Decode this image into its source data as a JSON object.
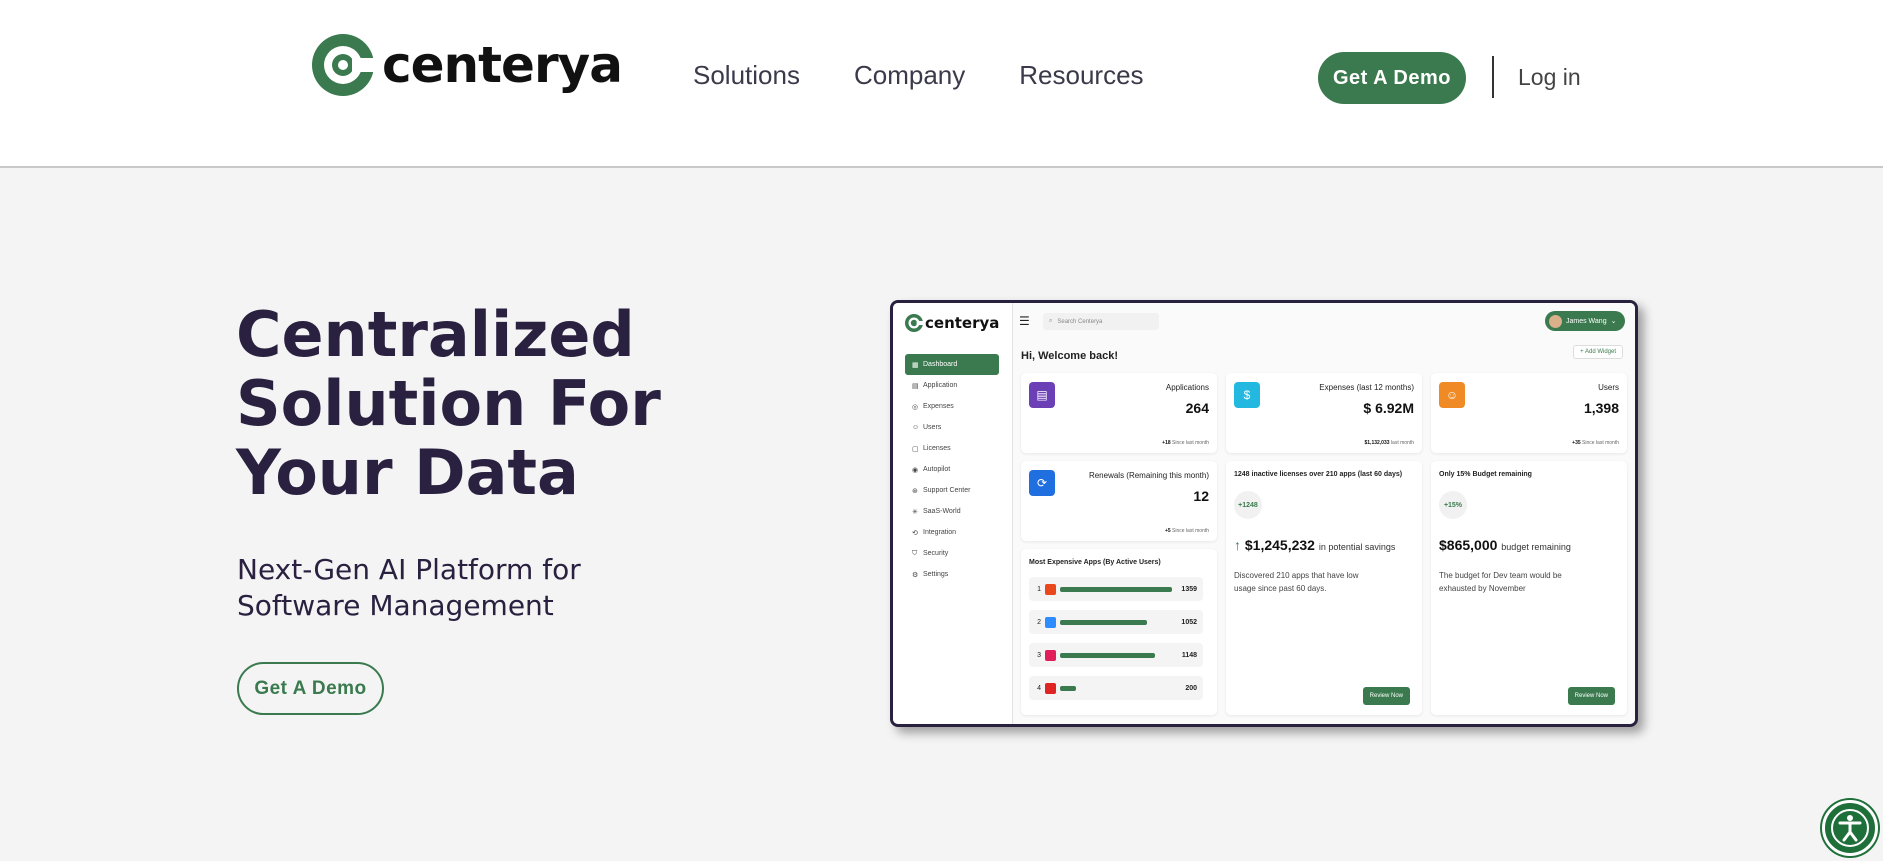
{
  "header": {
    "logo_text": "centerya",
    "nav": [
      "Solutions",
      "Company",
      "Resources"
    ],
    "cta_label": "Get A Demo",
    "login_label": "Log in",
    "brand_color": "#3a7a4e"
  },
  "hero": {
    "title": "Centralized Solution For Your Data",
    "subtitle": "Next-Gen AI Platform for Software Management",
    "cta_label": "Get A Demo"
  },
  "dashboard": {
    "logo_text": "centerya",
    "search_placeholder": "Search Centerya",
    "user_name": "James Wang",
    "welcome": "Hi, Welcome back!",
    "add_widget": "+ Add Widget",
    "menu": [
      {
        "label": "Dashboard",
        "icon": "grid-icon",
        "glyph": "▦"
      },
      {
        "label": "Application",
        "icon": "doc-icon",
        "glyph": "▤"
      },
      {
        "label": "Expenses",
        "icon": "coin-icon",
        "glyph": "◎"
      },
      {
        "label": "Users",
        "icon": "users-icon",
        "glyph": "☺"
      },
      {
        "label": "Licenses",
        "icon": "license-icon",
        "glyph": "▢"
      },
      {
        "label": "Autopilot",
        "icon": "autopilot-icon",
        "glyph": "◉"
      },
      {
        "label": "Support Center",
        "icon": "support-icon",
        "glyph": "⊛"
      },
      {
        "label": "SaaS-World",
        "icon": "world-icon",
        "glyph": "✳"
      },
      {
        "label": "Integration",
        "icon": "integration-icon",
        "glyph": "⟲"
      },
      {
        "label": "Security",
        "icon": "shield-icon",
        "glyph": "⛉"
      },
      {
        "label": "Settings",
        "icon": "gear-icon",
        "glyph": "⚙"
      }
    ],
    "stats": {
      "applications": {
        "label": "Applications",
        "value": "264",
        "since_num": "+18",
        "since_text": "Since last month",
        "color": "#6b3fb5"
      },
      "expenses": {
        "label": "Expenses (last 12 months)",
        "value": "$ 6.92M",
        "since_num": "$1,132,033",
        "since_text": "last month",
        "color": "#22b8e0"
      },
      "users": {
        "label": "Users",
        "value": "1,398",
        "since_num": "+35",
        "since_text": "Since last month",
        "color": "#f08a24"
      },
      "renewals": {
        "label": "Renewals (Remaining this month)",
        "value": "12",
        "since_num": "+5",
        "since_text": "Since last month",
        "color": "#1f6fe0"
      }
    },
    "inactive": {
      "title": "1248 inactive licenses over 210 apps (last 60 days)",
      "pill": "+1248",
      "value": "$1,245,232",
      "value_suffix": "in potential savings",
      "desc": "Discovered 210 apps that have low usage since past 60 days.",
      "button": "Review Now"
    },
    "budget": {
      "title": "Only 15% Budget remaining",
      "pill": "+15%",
      "value": "$865,000",
      "value_suffix": "budget remaining",
      "desc": "The budget for Dev team would be exhausted by November",
      "button": "Review Now"
    },
    "expensive_apps": {
      "title": "Most Expensive Apps (By Active Users)",
      "rows": [
        {
          "rank": "1",
          "icon": "office-icon",
          "icon_color": "#e8481c",
          "value": 1359,
          "label": "1359"
        },
        {
          "rank": "2",
          "icon": "zoom-icon",
          "icon_color": "#2d8cff",
          "value": 1052,
          "label": "1052"
        },
        {
          "rank": "3",
          "icon": "slack-icon",
          "icon_color": "#e01e5a",
          "value": 1148,
          "label": "1148"
        },
        {
          "rank": "4",
          "icon": "app-icon",
          "icon_color": "#e02424",
          "value": 200,
          "label": "200"
        }
      ]
    }
  }
}
